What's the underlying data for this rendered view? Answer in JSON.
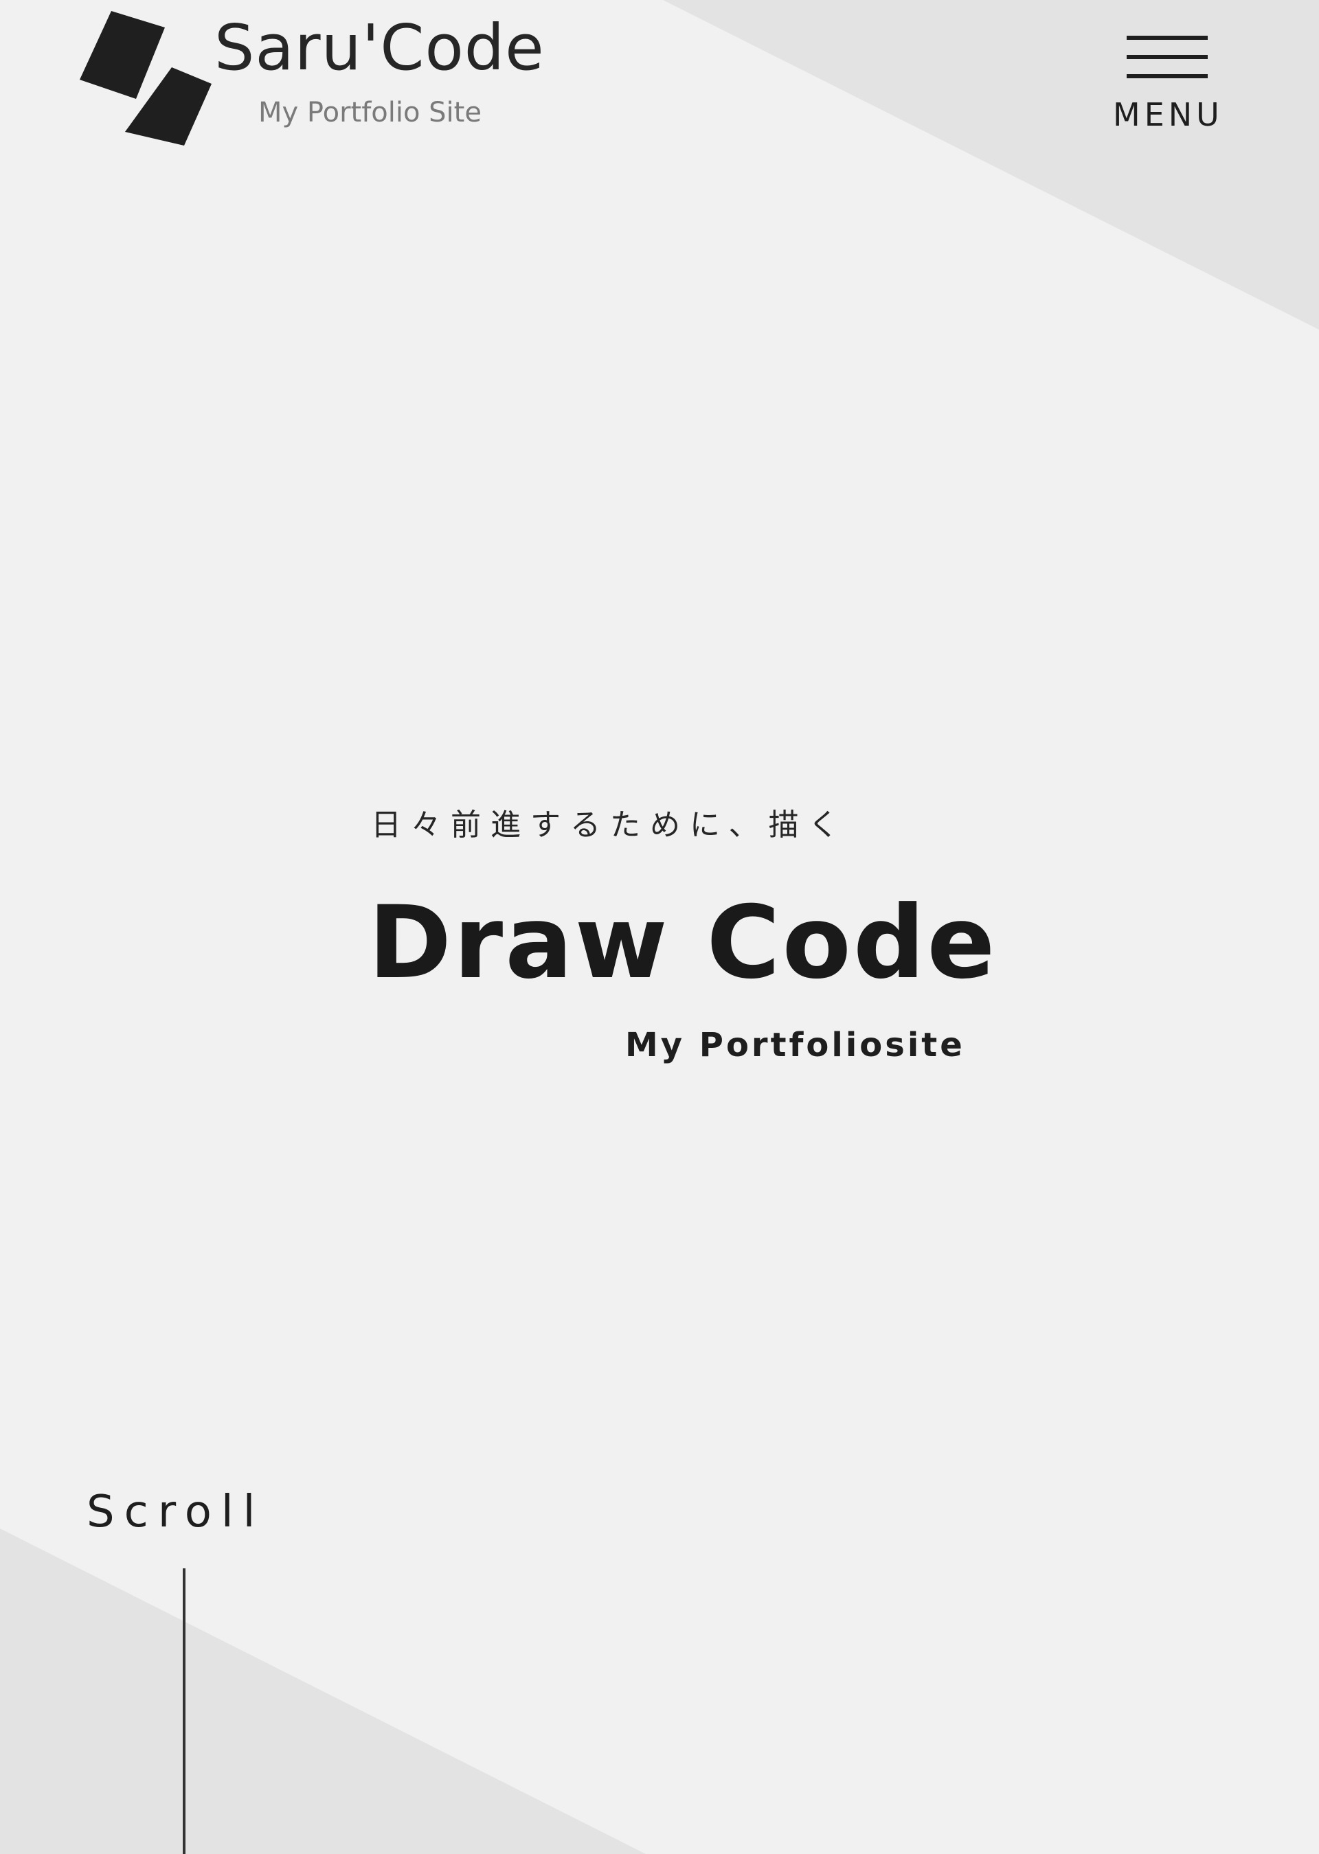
{
  "header": {
    "logo": {
      "title": "Saru'Code",
      "subtitle": "My Portfolio Site"
    },
    "menu": {
      "label": "MENU",
      "icon": "hamburger-icon"
    }
  },
  "hero": {
    "tagline": "日々前進するために、描く",
    "title": "Draw Code",
    "subtitle": "My Portfoliosite"
  },
  "scroll_indicator": {
    "label": "Scroll"
  },
  "colors": {
    "background": "#f1f1f1",
    "background_shape": "#e2e2e2",
    "text": "#1e1e1e",
    "muted_text": "#7a7a7a"
  }
}
